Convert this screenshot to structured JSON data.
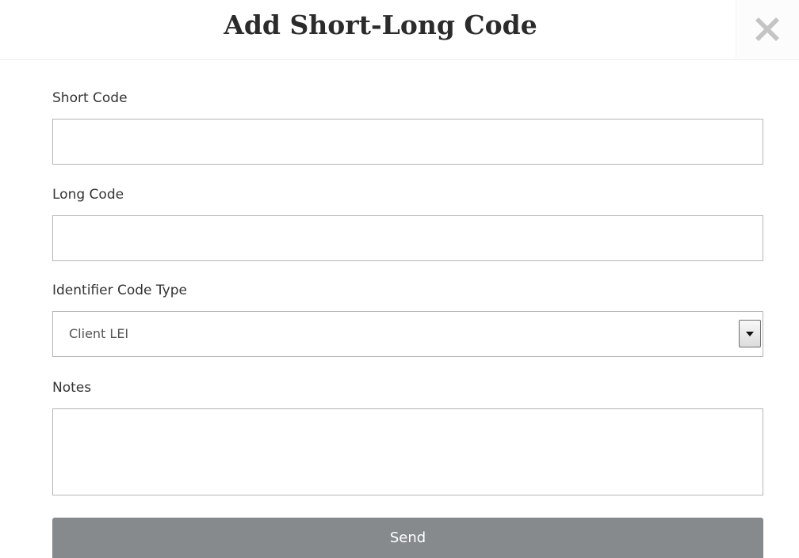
{
  "dialog": {
    "title": "Add Short-Long Code",
    "close_icon": "close-x-icon"
  },
  "form": {
    "short_code": {
      "label": "Short Code",
      "value": "",
      "placeholder": ""
    },
    "long_code": {
      "label": "Long Code",
      "value": "",
      "placeholder": ""
    },
    "identifier_code_type": {
      "label": "Identifier Code Type",
      "selected": "Client LEI",
      "arrow_icon": "chevron-down-icon"
    },
    "notes": {
      "label": "Notes",
      "value": "",
      "placeholder": ""
    },
    "send_label": "Send"
  },
  "colors": {
    "title_text": "#2b2b2b",
    "label_text": "#333333",
    "input_border": "#b5b5b5",
    "send_button_bg": "#868a8d",
    "send_button_text": "#ffffff",
    "close_icon": "#c4c4c4"
  }
}
